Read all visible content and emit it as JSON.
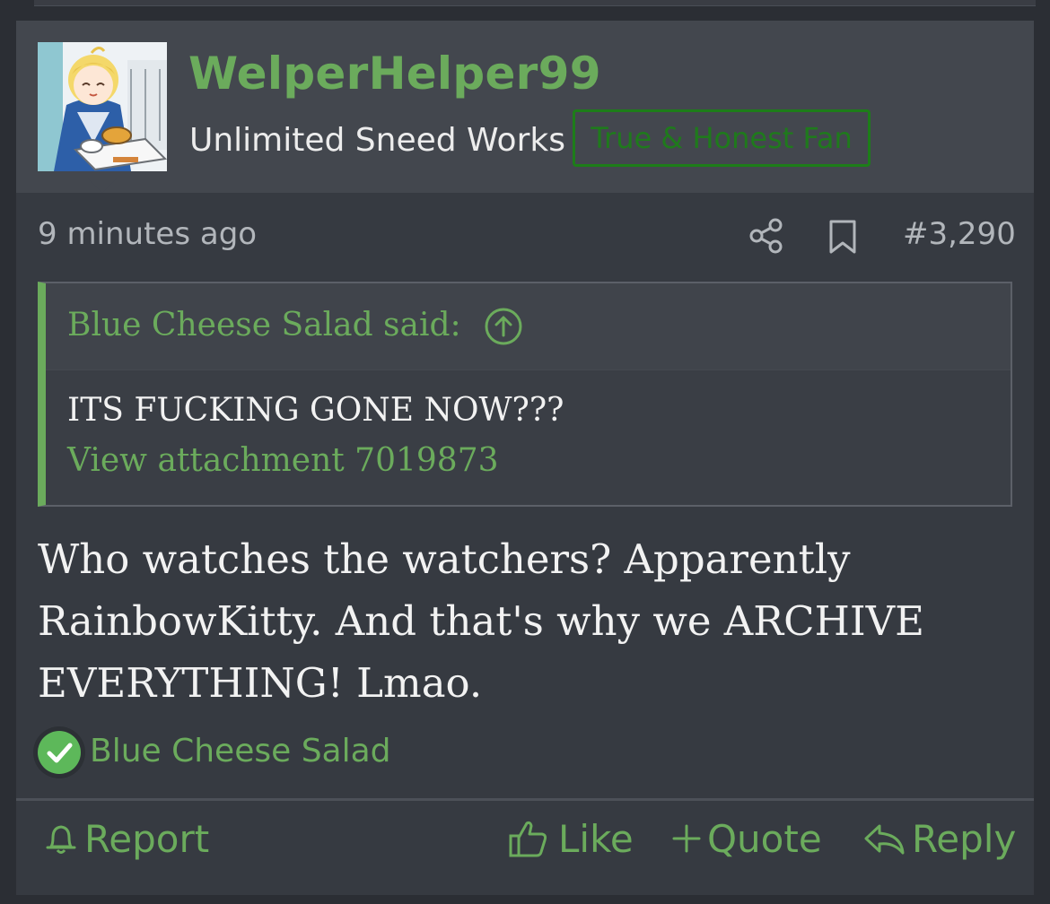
{
  "post": {
    "author": {
      "username": "WelperHelper99",
      "title": "Unlimited Sneed Works",
      "badge": "True & Honest Fan"
    },
    "timestamp": "9 minutes ago",
    "post_number": "#3,290",
    "quote": {
      "author_line": "Blue Cheese Salad said:",
      "text": "ITS FUCKING GONE NOW???",
      "attachment_link": "View attachment 7019873"
    },
    "body_lines": [
      "Who watches the watchers? Apparently",
      "RainbowKitty. And that's why we ARCHIVE",
      "EVERYTHING! Lmao."
    ],
    "reactions": {
      "icon": "check-circle-icon",
      "users": "Blue Cheese Salad"
    },
    "actions": {
      "report": "Report",
      "like": "Like",
      "quote": "Quote",
      "reply": "Reply"
    }
  },
  "colors": {
    "accent_green": "#6bab5c",
    "badge_green": "#1f7a1c",
    "post_bg": "#363a41",
    "header_bg": "#43474e",
    "text": "#f2f2f2",
    "muted_text": "#b2b6bb"
  }
}
